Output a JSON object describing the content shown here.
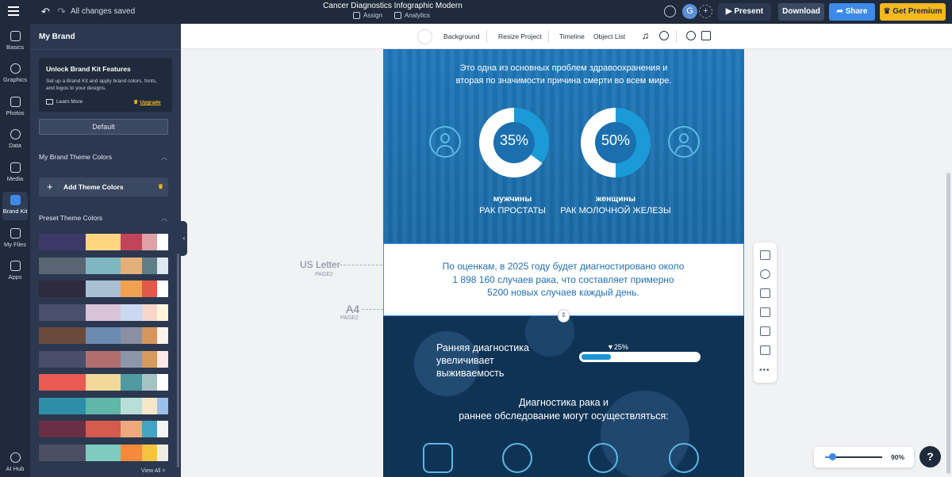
{
  "topbar": {
    "saved_status": "All changes saved",
    "project_title": "Cancer Diagnostics Infographic Modern",
    "assign_label": "Assign",
    "analytics_label": "Analytics",
    "avatar_letter": "G",
    "present_label": "Present",
    "download_label": "Download",
    "share_label": "Share",
    "premium_label": "Get Premium"
  },
  "rail": {
    "items": [
      {
        "label": "Basics",
        "icon": "text-icon"
      },
      {
        "label": "Graphics",
        "icon": "shapes-icon"
      },
      {
        "label": "Photos",
        "icon": "image-icon"
      },
      {
        "label": "Data",
        "icon": "pie-chart-icon"
      },
      {
        "label": "Media",
        "icon": "video-icon"
      },
      {
        "label": "Brand Kit",
        "icon": "brand-kit-icon",
        "active": true
      },
      {
        "label": "My Files",
        "icon": "folder-icon"
      },
      {
        "label": "Apps",
        "icon": "apps-grid-icon"
      },
      {
        "label": "AI Hub",
        "icon": "sparkle-icon"
      }
    ]
  },
  "panel": {
    "title": "My Brand",
    "unlock_title": "Unlock Brand Kit Features",
    "unlock_desc": "Set up a Brand Kit and apply brand colors, fonts, and logos to your designs.",
    "learn_more": "Learn More",
    "upgrade": "Upgrade",
    "default_btn": "Default",
    "theme_colors_head": "My Brand Theme Colors",
    "add_theme_colors": "Add Theme Colors",
    "preset_head": "Preset Theme Colors",
    "view_all": "View All >",
    "palettes": [
      [
        "#3d3a68",
        "#ffd580",
        "#c0445a",
        "#dfa1a5",
        "#ffffff"
      ],
      [
        "#5a6573",
        "#7fb7c0",
        "#e3b07a",
        "#5e7f88",
        "#dfe7f3"
      ],
      [
        "#2f2b3f",
        "#a9c0d3",
        "#f0a252",
        "#e15949",
        "#ffffff"
      ],
      [
        "#4a4f6e",
        "#d9c3d9",
        "#c9d9f0",
        "#f6d6c8",
        "#fff5dc"
      ],
      [
        "#6a4a3c",
        "#6b8bb3",
        "#8a8fa2",
        "#d6955c",
        "#fdf2ec"
      ],
      [
        "#4a4e6a",
        "#b26e6e",
        "#8b96a8",
        "#d79a5c",
        "#fde8e8"
      ],
      [
        "#e85a52",
        "#f2d99a",
        "#4f9aa0",
        "#a6c3c4",
        "#ffffff"
      ],
      [
        "#2c8ea8",
        "#5fb7a9",
        "#b7dfd7",
        "#f6e7c8",
        "#9bc0ea"
      ],
      [
        "#6a2f45",
        "#d55b4e",
        "#f0a87e",
        "#43a3c2",
        "#f4f4f4"
      ],
      [
        "#4b4f63",
        "#7fcbc0",
        "#f58a3c",
        "#f5c542",
        "#f1ece2"
      ]
    ]
  },
  "canvas_toolbar": {
    "background": "Background",
    "resize": "Resize Project",
    "timeline": "Timeline",
    "object_list": "Object List"
  },
  "page_labels": {
    "us_letter": "US Letter",
    "page2_a": "PAGE2",
    "a4": "A4",
    "page2_b": "PAGE2"
  },
  "infographic": {
    "intro_line1": "Это одна из основных проблем здравоохранения  и",
    "intro_line2": "вторая по значимости причина смерти во всем мире.",
    "donut_men_value": "35%",
    "donut_men_fraction": 0.35,
    "donut_women_value": "50%",
    "donut_women_fraction": 0.5,
    "men_bold": "мужчины",
    "men_caption": "РАК ПРОСТАТЫ",
    "women_bold": "женщины",
    "women_caption": "РАК МОЛОЧНОЙ ЖЕЛЕЗЫ",
    "estimate_line1": "По оценкам, в 2025 году будет диагностировано около",
    "estimate_line2": "1 898 160 случаев рака, что составляет примерно",
    "estimate_line3": "5200 новых случаев каждый день.",
    "early_line1": "Ранняя диагностика",
    "early_line2": "увеличивает",
    "early_line3": "выживаемость",
    "progress_label": "▼25%",
    "progress_fraction": 0.25,
    "diag_line1": "Диагностика рака и",
    "diag_line2": "раннее обследование могут осуществляться:",
    "donut_color": "#1a9bd7",
    "donut_track": "#ffffff"
  },
  "zoom": {
    "value": "90%",
    "fraction": 0.07
  },
  "help": {
    "label": "?"
  }
}
